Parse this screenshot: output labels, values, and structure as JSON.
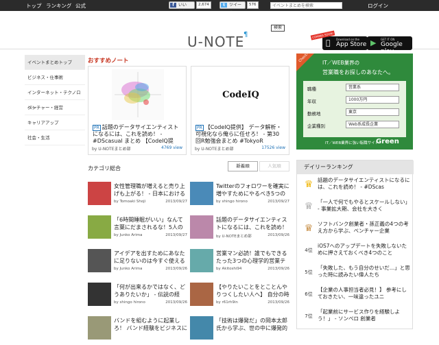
{
  "topbar": {
    "nav": [
      "トップ",
      "ランキング",
      "公式"
    ],
    "like_label": "いいね！",
    "like_count": "2,674",
    "tweet_label": "ツイート",
    "tweet_count": "576",
    "search_placeholder": "イベントまとめを検索",
    "search_button": "検索",
    "login": "ログイン"
  },
  "header": {
    "logo": "U-NOTE",
    "coming_soon": "COMING SOON!",
    "appstore_small": "Download on the",
    "appstore_label": "App Store",
    "googleplay_small": "GET IT ON",
    "googleplay_label": "Google play"
  },
  "sidebar": {
    "items": [
      {
        "label": "イベントまとめトップ",
        "active": true
      },
      {
        "label": "ビジネス・仕事術",
        "active": false
      },
      {
        "label": "インターネット・テクノロジー",
        "active": false
      },
      {
        "label": "ベンチャー・経営",
        "active": false
      },
      {
        "label": "キャリアアップ",
        "active": false
      },
      {
        "label": "社会・生活",
        "active": false
      }
    ]
  },
  "recommended": {
    "heading": "おすすめノート",
    "cards": [
      {
        "pr": "PR",
        "title": "話題のデータサイエンティストになるには、これを読め！ - #DScasual まとめ 【CodeIQ提供】 #",
        "by": "by U-NOTEまとめ部",
        "views": "4769 view",
        "thumb_text": ""
      },
      {
        "pr": "PR",
        "title": "【CodeIQ提供】 データ解析・可視化なら俺らに任せろ！ - 第30回R勉強会まとめ #TokyoR",
        "by": "by U-NOTEまとめ部",
        "views": "17526 view",
        "thumb_text": "CodeIQ"
      }
    ]
  },
  "category": {
    "heading": "カテゴリ総合",
    "tab_new": "新着順",
    "tab_popular": "人気順",
    "articles": [
      {
        "title": "女性管理職が増えると売り上げも上がる！ - 日本における",
        "by": "by Tomoaki Shoji",
        "date": "2013/09/27"
      },
      {
        "title": "Twitterのフォロワーを確実に増やすためにやるべき5つの",
        "by": "by shingo hirono",
        "date": "2013/09/27"
      },
      {
        "title": "「6時間睡眠がいい」なんて言葉にだまされるな！5人の",
        "by": "by Junko Arima",
        "date": "2013/09/27"
      },
      {
        "title": "話題のデータサイエンティストになるには、これを読め！ -",
        "by": "by U-NOTEまとめ部",
        "date": "2013/09/26"
      },
      {
        "title": "アイデアを出すためにあなたに足りないのは今すぐ使える",
        "by": "by Junko Arima",
        "date": "2013/09/26"
      },
      {
        "title": "営業マン必読！誰でもできるたった3つの心理学的営業テ",
        "by": "by Akitoshi94",
        "date": "2013/09/26"
      },
      {
        "title": "「何が出来るかではなく、どうありたいか」 - 伝説の経",
        "by": "by shingo hirono",
        "date": "2013/09/26"
      },
      {
        "title": "【やりたいことをとことんやりつくしたい人へ】 自分の時",
        "by": "by r61rh9in",
        "date": "2013/09/26"
      },
      {
        "title": "バンドを組むように起業しろ！ バンド経験をビジネスに",
        "by": "",
        "date": ""
      },
      {
        "title": "「技術は爆発だ」の岡本太郎氏から学ぶ、世の中に爆発的",
        "by": "",
        "date": ""
      }
    ]
  },
  "ad": {
    "badge": "Check!",
    "line1": "IT／WEB業界の",
    "line2": "営業職をお探しのあなたへ。",
    "rows": [
      {
        "label": "職種",
        "value": "営業系"
      },
      {
        "label": "年収",
        "value": "1000万円"
      },
      {
        "label": "勤務地",
        "value": "東京"
      },
      {
        "label": "企業種別",
        "value": "Web系成長企業"
      }
    ],
    "footer": "IT／WEB業界に強い転職サイト",
    "brand": "Green"
  },
  "ranking": {
    "heading": "デイリーランキング",
    "items": [
      {
        "rank": "1",
        "title": "話題のデータサイエンティストになるには、これを読め！ - #DScas"
      },
      {
        "rank": "2",
        "title": "「一人で何でもやるとスケールしない」 - 事業拡大期、会社を大きく"
      },
      {
        "rank": "3",
        "title": "ソフトバンク創業者・孫正義の4つの考え方から学ぶ、ベンチャー企業"
      },
      {
        "rank": "4位",
        "title": "iOS7へのアップデートを失敗しないために押さえておくべき4つのこと"
      },
      {
        "rank": "5位",
        "title": "「失敗した、もう自分のせいだ…」と思った時に読みたい偉人たち"
      },
      {
        "rank": "6位",
        "title": "【企業の人事担当者必見！】 参考にしておきたい、一味違ったユニ"
      },
      {
        "rank": "7位",
        "title": "「起業前にサービス作りを経験しよう！」 - ソンベロ 創業者"
      }
    ]
  },
  "colors": {
    "accent_red": "#c6321d",
    "link_blue": "#1a6fb5",
    "ad_green": "#2f8a3c",
    "topbar": "#2b2b2b"
  }
}
